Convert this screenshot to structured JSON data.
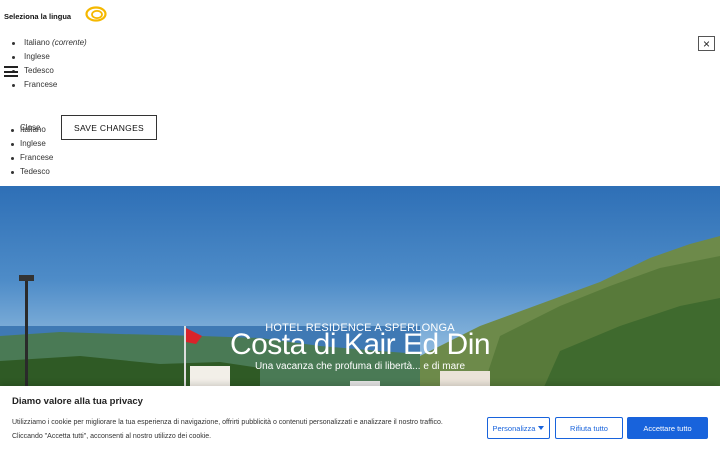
{
  "language_selector": {
    "title": "Seleziona la lingua",
    "current_language": "Italiano",
    "current_marker": "(corrente)",
    "options": [
      "Inglese",
      "Tedesco",
      "Francese"
    ],
    "close_label": "Close",
    "save_label": "SAVE CHANGES",
    "close_icon": "×"
  },
  "menu_languages": [
    "Italiano",
    "Inglese",
    "Francese",
    "Tedesco"
  ],
  "hero": {
    "subtitle": "HOTEL RESIDENCE A SPERLONGA",
    "title": "Costa di Kair Ed Din",
    "tagline": "Una vacanza che profuma di libertà... e di mare"
  },
  "cookie_banner": {
    "title": "Diamo valore alla tua privacy",
    "text_line1": "Utilizziamo i cookie per migliorare la tua esperienza di navigazione, offrirti pubblicità o contenuti personalizzati e analizzare il nostro traffico.",
    "text_line2": "Cliccando \"Accetta tutti\", acconsenti al nostro utilizzo dei cookie.",
    "customize_label": "Personalizza",
    "reject_label": "Rifiuta tutto",
    "accept_label": "Accettare tutto"
  },
  "colors": {
    "accent": "#1863dc",
    "logo": "#f5b800"
  }
}
